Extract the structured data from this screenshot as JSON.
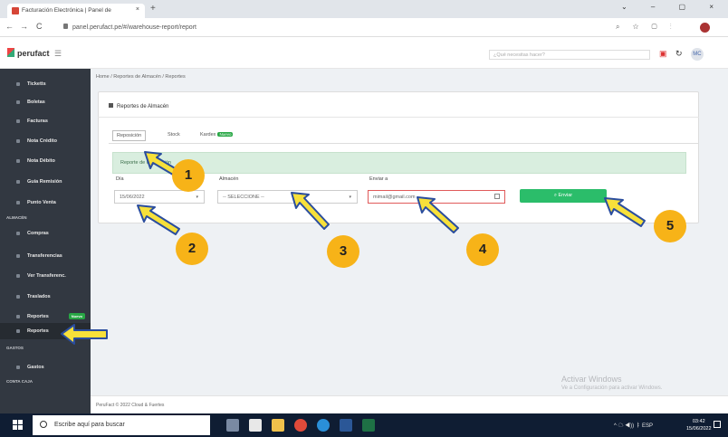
{
  "browser": {
    "tab_title": "Facturación Electrónica | Panel de",
    "tab_close": "×",
    "new_tab": "+",
    "url": "panel.perufact.pe/#/warehouse-report/report",
    "nav_back": "←",
    "nav_forward": "→",
    "reload": "C",
    "window_controls": "⌄ – ▢ ×"
  },
  "header": {
    "logo": "perufact",
    "search_placeholder": "¿Qué necesitas hacer?",
    "user_initials": "MC"
  },
  "sidebar": {
    "items": [
      {
        "label": "Ticketts"
      },
      {
        "label": "Boletas"
      },
      {
        "label": "Facturas"
      },
      {
        "label": "Nota Crédito"
      },
      {
        "label": "Nota Débito"
      },
      {
        "label": "Guía Remisión"
      },
      {
        "label": "Punto Venta"
      },
      {
        "label": "Compras"
      },
      {
        "label": "Transferencias"
      },
      {
        "label": "Ver Transferenc."
      },
      {
        "label": "Traslados"
      },
      {
        "label": "Reportes",
        "badge": "Nuevo"
      },
      {
        "label": "Reportes"
      },
      {
        "label": "Gastos"
      }
    ],
    "sections": [
      "ALMACÉN",
      "GASTOS",
      "CONTA CAJA"
    ]
  },
  "breadcrumb": "Home  /  Reportes de Almacén  /  Reportes",
  "card": {
    "title": "Reportes de Almacén",
    "tabs": [
      {
        "label": "Reposición"
      },
      {
        "label": "Stock"
      },
      {
        "label": "Kardex",
        "badge": "Nuevo"
      }
    ],
    "alert": "Reporte de Reposición",
    "fields": {
      "date_label": "Día",
      "date_value": "15/06/2022",
      "warehouse_label": "Almacén",
      "warehouse_value": "-- SELECCIONE --",
      "email_label": "Enviar a",
      "email_value": "mimail@gmail.com"
    },
    "send_button": "Enviar"
  },
  "footer": "PeruFact © 2022 Cloud & Fuertes",
  "watermark": {
    "line1": "Activar Windows",
    "line2": "Ve a Configuración para activar Windows."
  },
  "taskbar": {
    "search_placeholder": "Escribe aquí para buscar",
    "tray": "^ ☁ ◀)) ㅑ ESP",
    "time": "03:42",
    "date": "15/06/2022"
  },
  "annotations": [
    "1",
    "2",
    "3",
    "4",
    "5"
  ],
  "colors": {
    "sidebar": "#323841",
    "accent_green": "#2bbd6a",
    "annotation_yellow": "#f7b318",
    "arrow_fill": "#f7e03a",
    "arrow_stroke": "#2a4d9e"
  }
}
